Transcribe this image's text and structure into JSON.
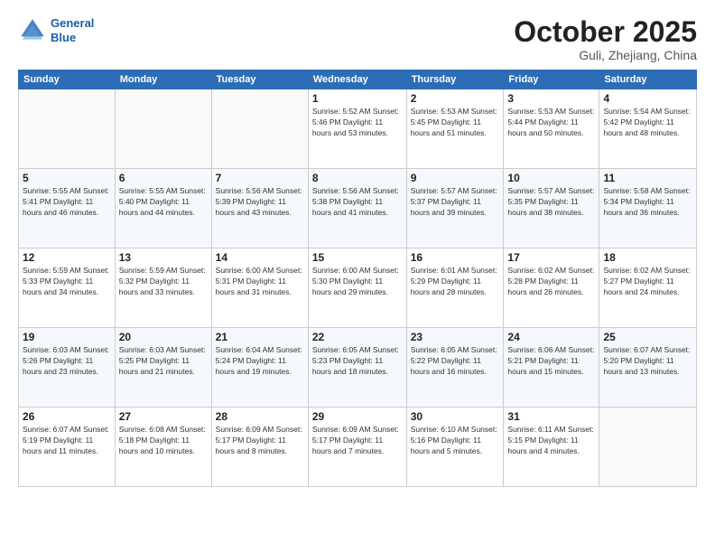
{
  "logo": {
    "line1": "General",
    "line2": "Blue"
  },
  "title": "October 2025",
  "subtitle": "Guli, Zhejiang, China",
  "weekdays": [
    "Sunday",
    "Monday",
    "Tuesday",
    "Wednesday",
    "Thursday",
    "Friday",
    "Saturday"
  ],
  "weeks": [
    [
      {
        "day": "",
        "info": ""
      },
      {
        "day": "",
        "info": ""
      },
      {
        "day": "",
        "info": ""
      },
      {
        "day": "1",
        "info": "Sunrise: 5:52 AM\nSunset: 5:46 PM\nDaylight: 11 hours\nand 53 minutes."
      },
      {
        "day": "2",
        "info": "Sunrise: 5:53 AM\nSunset: 5:45 PM\nDaylight: 11 hours\nand 51 minutes."
      },
      {
        "day": "3",
        "info": "Sunrise: 5:53 AM\nSunset: 5:44 PM\nDaylight: 11 hours\nand 50 minutes."
      },
      {
        "day": "4",
        "info": "Sunrise: 5:54 AM\nSunset: 5:42 PM\nDaylight: 11 hours\nand 48 minutes."
      }
    ],
    [
      {
        "day": "5",
        "info": "Sunrise: 5:55 AM\nSunset: 5:41 PM\nDaylight: 11 hours\nand 46 minutes."
      },
      {
        "day": "6",
        "info": "Sunrise: 5:55 AM\nSunset: 5:40 PM\nDaylight: 11 hours\nand 44 minutes."
      },
      {
        "day": "7",
        "info": "Sunrise: 5:56 AM\nSunset: 5:39 PM\nDaylight: 11 hours\nand 43 minutes."
      },
      {
        "day": "8",
        "info": "Sunrise: 5:56 AM\nSunset: 5:38 PM\nDaylight: 11 hours\nand 41 minutes."
      },
      {
        "day": "9",
        "info": "Sunrise: 5:57 AM\nSunset: 5:37 PM\nDaylight: 11 hours\nand 39 minutes."
      },
      {
        "day": "10",
        "info": "Sunrise: 5:57 AM\nSunset: 5:35 PM\nDaylight: 11 hours\nand 38 minutes."
      },
      {
        "day": "11",
        "info": "Sunrise: 5:58 AM\nSunset: 5:34 PM\nDaylight: 11 hours\nand 36 minutes."
      }
    ],
    [
      {
        "day": "12",
        "info": "Sunrise: 5:59 AM\nSunset: 5:33 PM\nDaylight: 11 hours\nand 34 minutes."
      },
      {
        "day": "13",
        "info": "Sunrise: 5:59 AM\nSunset: 5:32 PM\nDaylight: 11 hours\nand 33 minutes."
      },
      {
        "day": "14",
        "info": "Sunrise: 6:00 AM\nSunset: 5:31 PM\nDaylight: 11 hours\nand 31 minutes."
      },
      {
        "day": "15",
        "info": "Sunrise: 6:00 AM\nSunset: 5:30 PM\nDaylight: 11 hours\nand 29 minutes."
      },
      {
        "day": "16",
        "info": "Sunrise: 6:01 AM\nSunset: 5:29 PM\nDaylight: 11 hours\nand 28 minutes."
      },
      {
        "day": "17",
        "info": "Sunrise: 6:02 AM\nSunset: 5:28 PM\nDaylight: 11 hours\nand 26 minutes."
      },
      {
        "day": "18",
        "info": "Sunrise: 6:02 AM\nSunset: 5:27 PM\nDaylight: 11 hours\nand 24 minutes."
      }
    ],
    [
      {
        "day": "19",
        "info": "Sunrise: 6:03 AM\nSunset: 5:26 PM\nDaylight: 11 hours\nand 23 minutes."
      },
      {
        "day": "20",
        "info": "Sunrise: 6:03 AM\nSunset: 5:25 PM\nDaylight: 11 hours\nand 21 minutes."
      },
      {
        "day": "21",
        "info": "Sunrise: 6:04 AM\nSunset: 5:24 PM\nDaylight: 11 hours\nand 19 minutes."
      },
      {
        "day": "22",
        "info": "Sunrise: 6:05 AM\nSunset: 5:23 PM\nDaylight: 11 hours\nand 18 minutes."
      },
      {
        "day": "23",
        "info": "Sunrise: 6:05 AM\nSunset: 5:22 PM\nDaylight: 11 hours\nand 16 minutes."
      },
      {
        "day": "24",
        "info": "Sunrise: 6:06 AM\nSunset: 5:21 PM\nDaylight: 11 hours\nand 15 minutes."
      },
      {
        "day": "25",
        "info": "Sunrise: 6:07 AM\nSunset: 5:20 PM\nDaylight: 11 hours\nand 13 minutes."
      }
    ],
    [
      {
        "day": "26",
        "info": "Sunrise: 6:07 AM\nSunset: 5:19 PM\nDaylight: 11 hours\nand 11 minutes."
      },
      {
        "day": "27",
        "info": "Sunrise: 6:08 AM\nSunset: 5:18 PM\nDaylight: 11 hours\nand 10 minutes."
      },
      {
        "day": "28",
        "info": "Sunrise: 6:09 AM\nSunset: 5:17 PM\nDaylight: 11 hours\nand 8 minutes."
      },
      {
        "day": "29",
        "info": "Sunrise: 6:09 AM\nSunset: 5:17 PM\nDaylight: 11 hours\nand 7 minutes."
      },
      {
        "day": "30",
        "info": "Sunrise: 6:10 AM\nSunset: 5:16 PM\nDaylight: 11 hours\nand 5 minutes."
      },
      {
        "day": "31",
        "info": "Sunrise: 6:11 AM\nSunset: 5:15 PM\nDaylight: 11 hours\nand 4 minutes."
      },
      {
        "day": "",
        "info": ""
      }
    ]
  ]
}
